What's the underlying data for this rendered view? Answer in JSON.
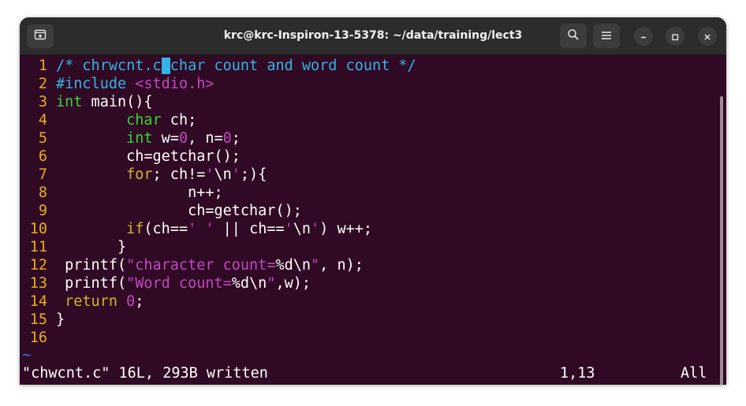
{
  "window": {
    "title": "krc@krc-Inspiron-13-5378: ~/data/training/lect3"
  },
  "editor": {
    "line_numbers": [
      "1",
      "2",
      "3",
      "4",
      "5",
      "6",
      "7",
      "8",
      "9",
      "10",
      "11",
      "12",
      "13",
      "14",
      "15",
      "16"
    ],
    "lines": [
      {
        "tokens": [
          {
            "t": "/* chrwcnt.c",
            "c": "c-comment"
          },
          {
            "t": " ",
            "c": "cursor"
          },
          {
            "t": "char count and word count */",
            "c": "c-comment"
          }
        ]
      },
      {
        "tokens": [
          {
            "t": "#include ",
            "c": "c-pre"
          },
          {
            "t": "<stdio.h>",
            "c": "c-string"
          }
        ]
      },
      {
        "tokens": [
          {
            "t": "int",
            "c": "c-type"
          },
          {
            "t": " main(){",
            "c": "c-white"
          }
        ]
      },
      {
        "tokens": [
          {
            "t": "        ",
            "c": "c-white"
          },
          {
            "t": "char",
            "c": "c-type"
          },
          {
            "t": " ch;",
            "c": "c-white"
          }
        ]
      },
      {
        "tokens": [
          {
            "t": "        ",
            "c": "c-white"
          },
          {
            "t": "int",
            "c": "c-type"
          },
          {
            "t": " w=",
            "c": "c-white"
          },
          {
            "t": "0",
            "c": "c-num"
          },
          {
            "t": ", n=",
            "c": "c-white"
          },
          {
            "t": "0",
            "c": "c-num"
          },
          {
            "t": ";",
            "c": "c-white"
          }
        ]
      },
      {
        "tokens": [
          {
            "t": "        ch=getchar();",
            "c": "c-white"
          }
        ]
      },
      {
        "tokens": [
          {
            "t": "        ",
            "c": "c-white"
          },
          {
            "t": "for",
            "c": "c-kw"
          },
          {
            "t": "; ch!=",
            "c": "c-white"
          },
          {
            "t": "'",
            "c": "c-string"
          },
          {
            "t": "\\n",
            "c": "c-white"
          },
          {
            "t": "'",
            "c": "c-string"
          },
          {
            "t": ";){",
            "c": "c-white"
          }
        ]
      },
      {
        "tokens": [
          {
            "t": "               n++;",
            "c": "c-white"
          }
        ]
      },
      {
        "tokens": [
          {
            "t": "               ch=getchar();",
            "c": "c-white"
          }
        ]
      },
      {
        "tokens": [
          {
            "t": "        ",
            "c": "c-white"
          },
          {
            "t": "if",
            "c": "c-kw"
          },
          {
            "t": "(ch==",
            "c": "c-white"
          },
          {
            "t": "' '",
            "c": "c-string"
          },
          {
            "t": " || ch==",
            "c": "c-white"
          },
          {
            "t": "'",
            "c": "c-string"
          },
          {
            "t": "\\n",
            "c": "c-white"
          },
          {
            "t": "'",
            "c": "c-string"
          },
          {
            "t": ") w++;",
            "c": "c-white"
          }
        ]
      },
      {
        "tokens": [
          {
            "t": "       }",
            "c": "c-white"
          }
        ]
      },
      {
        "tokens": [
          {
            "t": " printf(",
            "c": "c-white"
          },
          {
            "t": "\"character count=",
            "c": "c-string"
          },
          {
            "t": "%d\\n",
            "c": "c-white"
          },
          {
            "t": "\"",
            "c": "c-string"
          },
          {
            "t": ", n);",
            "c": "c-white"
          }
        ]
      },
      {
        "tokens": [
          {
            "t": " printf(",
            "c": "c-white"
          },
          {
            "t": "\"Word count=",
            "c": "c-string"
          },
          {
            "t": "%d\\n",
            "c": "c-white"
          },
          {
            "t": "\"",
            "c": "c-string"
          },
          {
            "t": ",w);",
            "c": "c-white"
          }
        ]
      },
      {
        "tokens": [
          {
            "t": " ",
            "c": "c-white"
          },
          {
            "t": "return",
            "c": "c-kw"
          },
          {
            "t": " ",
            "c": "c-white"
          },
          {
            "t": "0",
            "c": "c-num"
          },
          {
            "t": ";",
            "c": "c-white"
          }
        ]
      },
      {
        "tokens": [
          {
            "t": "}",
            "c": "c-white"
          }
        ]
      },
      {
        "tokens": []
      }
    ],
    "empty_marker": "~"
  },
  "status": {
    "message": "\"chwcnt.c\" 16L, 293B written",
    "position": "1,13",
    "scroll": "All"
  },
  "icons": {
    "new_tab": "new-tab-icon",
    "search": "search-icon",
    "menu": "hamburger-menu-icon",
    "minimize": "minimize-icon",
    "maximize": "maximize-icon",
    "close": "close-icon"
  },
  "colors": {
    "terminal_bg": "#300a24",
    "line_number": "#e9ad1c",
    "comment": "#34b4e6",
    "string": "#c049c0",
    "type": "#3ad33a",
    "keyword": "#d0b429"
  }
}
